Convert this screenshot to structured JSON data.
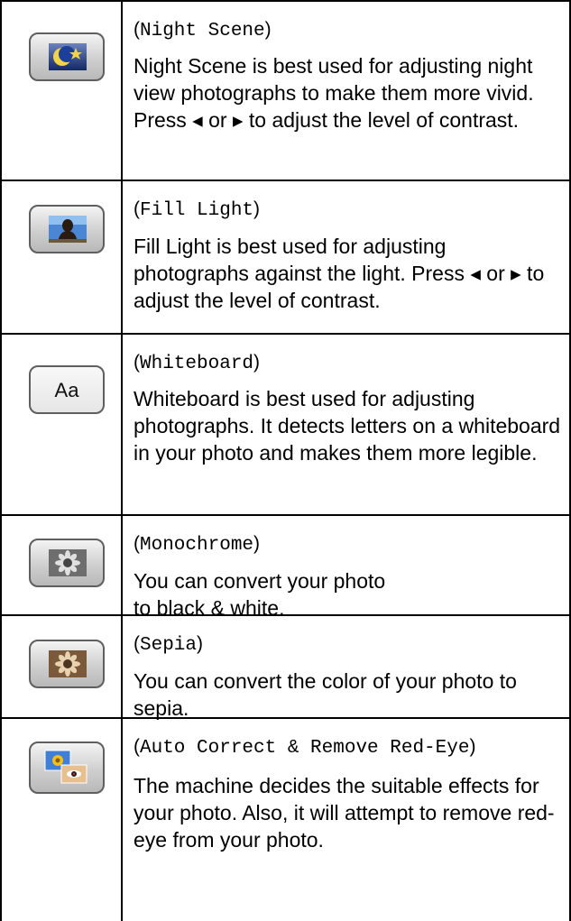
{
  "rows": [
    {
      "icon": "night-scene-icon",
      "name": "Night Scene",
      "description": "Night Scene is best used for adjusting night view photographs to make them more vivid. Press ◂ or ▸ to adjust the level of contrast."
    },
    {
      "icon": "fill-light-icon",
      "name": "Fill Light",
      "description": "Fill Light is best used for adjusting photographs against the light. Press ◂ or ▸ to adjust the level of contrast."
    },
    {
      "icon": "whiteboard-icon",
      "icon_text": "Aa",
      "name": "Whiteboard",
      "description": "Whiteboard is best used for adjusting photographs. It detects letters on a whiteboard in your photo and makes them more legible."
    },
    {
      "icon": "monochrome-icon",
      "name": "Monochrome",
      "description": "You can convert your photo to black & white."
    },
    {
      "icon": "sepia-icon",
      "name": "Sepia",
      "description": "You can convert the color of your photo to sepia."
    },
    {
      "icon": "auto-correct-red-eye-icon",
      "name": "Auto Correct & Remove Red-Eye",
      "description": "The machine decides the suitable effects for your photo. Also, it will attempt to remove red-eye from your photo."
    }
  ]
}
